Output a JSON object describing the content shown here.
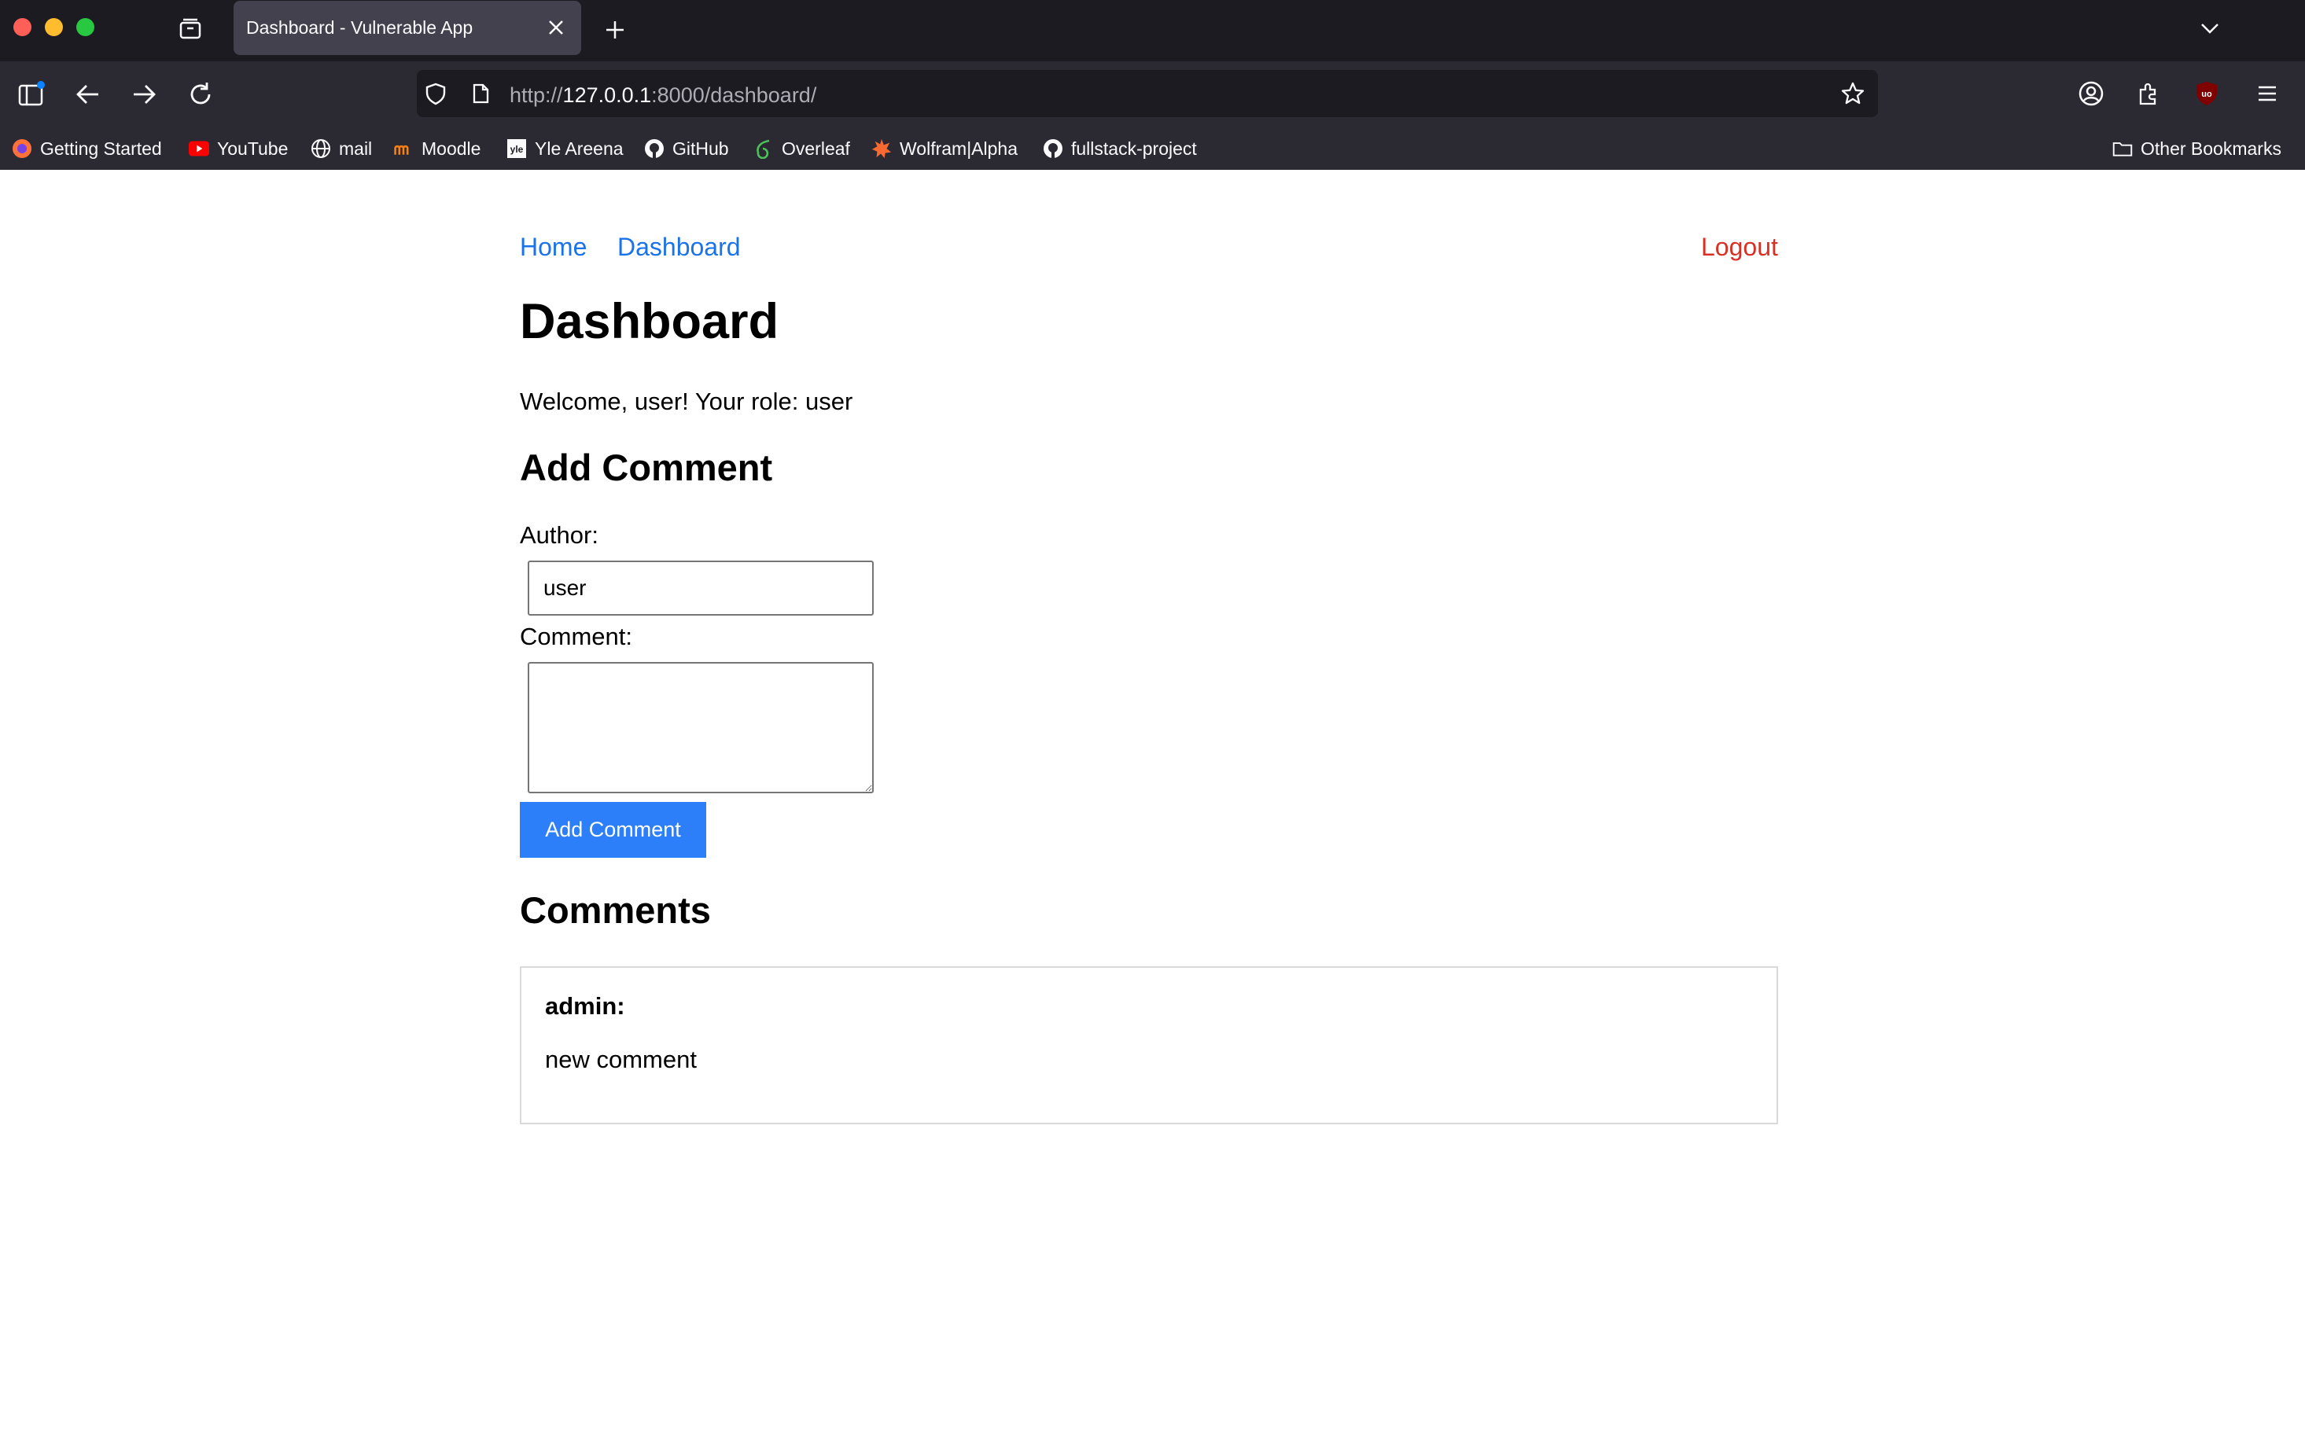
{
  "browser": {
    "tab_title": "Dashboard - Vulnerable App",
    "url_scheme": "http://",
    "url_host": "127.0.0.1",
    "url_rest": ":8000/dashboard/",
    "bookmarks": [
      {
        "label": "Getting Started",
        "icon": "firefox-icon"
      },
      {
        "label": "YouTube",
        "icon": "youtube-icon"
      },
      {
        "label": "mail",
        "icon": "globe-icon"
      },
      {
        "label": "Moodle",
        "icon": "moodle-icon"
      },
      {
        "label": "Yle Areena",
        "icon": "yle-icon"
      },
      {
        "label": "GitHub",
        "icon": "github-icon"
      },
      {
        "label": "Overleaf",
        "icon": "overleaf-icon"
      },
      {
        "label": "Wolfram|Alpha",
        "icon": "wolfram-icon"
      },
      {
        "label": "fullstack-project",
        "icon": "github-icon"
      }
    ],
    "other_bookmarks": "Other Bookmarks",
    "ublock_label": "uo"
  },
  "nav": {
    "home": "Home",
    "dashboard": "Dashboard",
    "logout": "Logout"
  },
  "main": {
    "title": "Dashboard",
    "welcome": "Welcome, user! Your role: user",
    "add_comment_heading": "Add Comment",
    "author_label": "Author:",
    "author_value": "user",
    "comment_label": "Comment:",
    "comment_value": "",
    "submit_label": "Add Comment",
    "comments_heading": "Comments",
    "comments": [
      {
        "author": "admin:",
        "text": "new comment"
      }
    ]
  },
  "colors": {
    "link": "#1a73e8",
    "logout": "#d93025",
    "button": "#2d7ff9",
    "chrome_bg": "#2b2a33",
    "tabstrip_bg": "#1c1b22"
  }
}
